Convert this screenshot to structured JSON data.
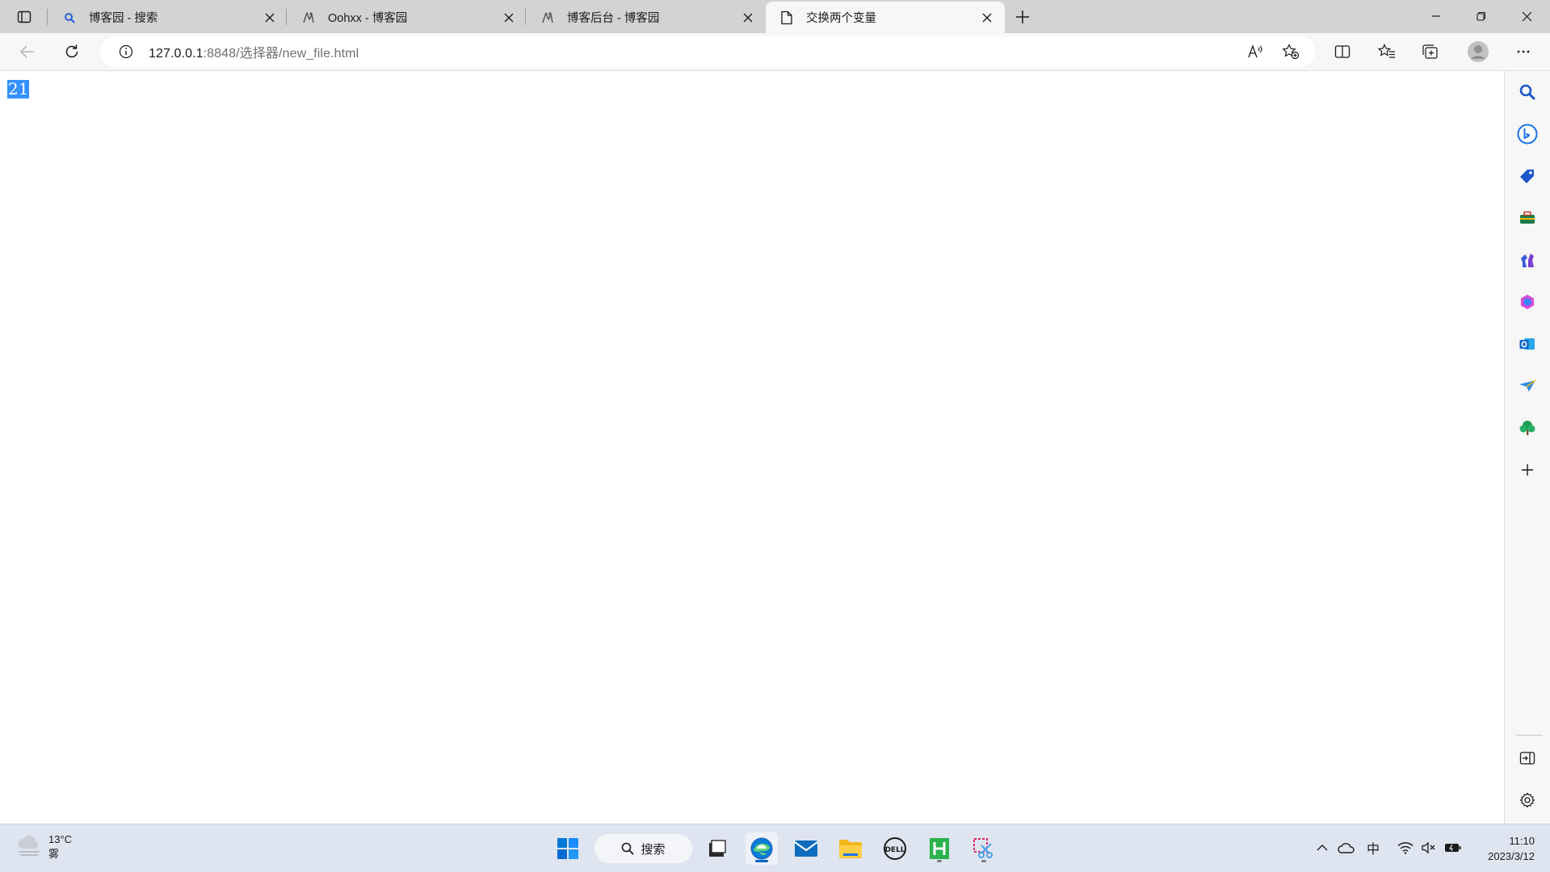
{
  "browser": {
    "tabs": [
      {
        "title": "博客园 - 搜索",
        "favicon": "search-favicon",
        "active": false
      },
      {
        "title": "Oohxx - 博客园",
        "favicon": "cnblogs-favicon",
        "active": false
      },
      {
        "title": "博客后台 - 博客园",
        "favicon": "cnblogs-favicon",
        "active": false
      },
      {
        "title": "交换两个变量",
        "favicon": "page-favicon",
        "active": true
      }
    ],
    "address": {
      "host": "127.0.0.1",
      "rest": ":8848/选择器/new_file.html"
    }
  },
  "page": {
    "selected_text": "21"
  },
  "sidebar": {
    "items": [
      "search-icon",
      "bing-icon",
      "shopping-icon",
      "tools-icon",
      "games-icon",
      "office-icon",
      "outlook-icon",
      "drop-icon",
      "tree-icon",
      "add-icon"
    ]
  },
  "taskbar": {
    "weather": {
      "temp": "13°C",
      "condition": "雾"
    },
    "search_label": "搜索",
    "ime": "中",
    "time": "11:10",
    "date": "2023/3/12"
  },
  "colors": {
    "selection": "#3390ff",
    "tabstrip": "#d3d3d3",
    "toolbar": "#f7f7f7",
    "taskbar": "#dfe5f0",
    "accent": "#0067c0"
  }
}
